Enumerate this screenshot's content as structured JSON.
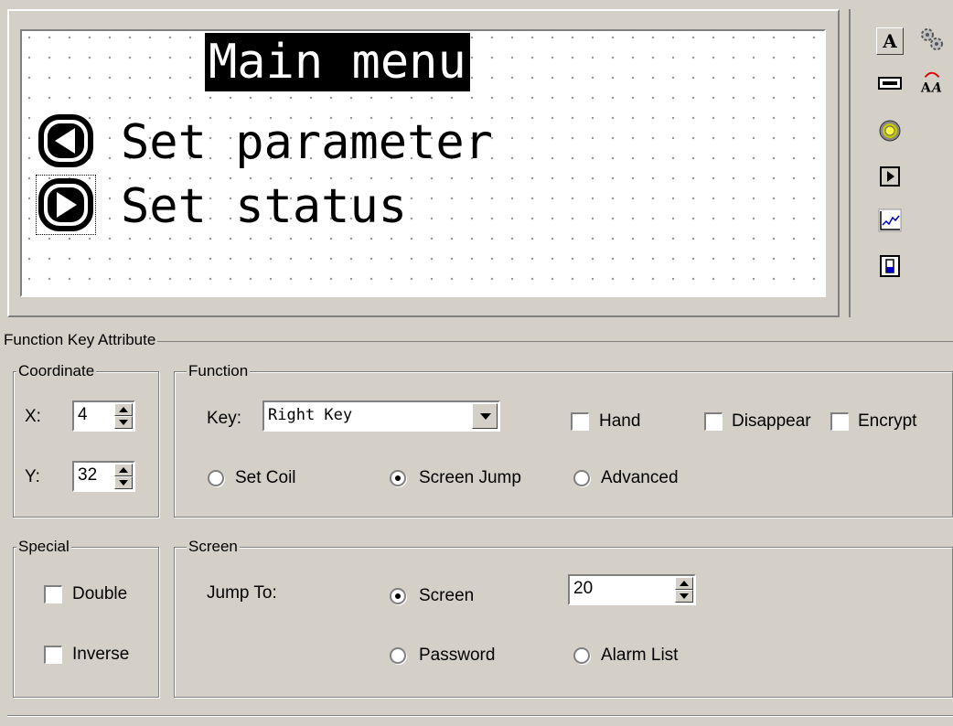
{
  "lcd": {
    "title": "Main menu",
    "line1": "Set parameter",
    "line2": "Set status"
  },
  "toolbox": {
    "text_tool_glyph": "A",
    "icons": [
      "text-icon",
      "gears-icon",
      "display-value-icon",
      "dynamic-text-icon",
      "indicator-lamp-icon",
      "function-key-icon",
      "trend-graph-icon",
      "bar-gauge-icon"
    ]
  },
  "attr": {
    "title": "Function Key Attribute",
    "coordinate": {
      "title": "Coordinate",
      "x_label": "X:",
      "x_value": "4",
      "y_label": "Y:",
      "y_value": "32"
    },
    "function": {
      "title": "Function",
      "key_label": "Key:",
      "key_value": "Right Key",
      "hand": "Hand",
      "disappear": "Disappear",
      "encrypt": "Encrypt",
      "set_coil": "Set Coil",
      "screen_jump": "Screen Jump",
      "advanced": "Advanced",
      "selected": "Screen Jump"
    },
    "special": {
      "title": "Special",
      "double": "Double",
      "inverse": "Inverse"
    },
    "screen": {
      "title": "Screen",
      "jump_to": "Jump To:",
      "screen_option": "Screen",
      "screen_value": "20",
      "password": "Password",
      "alarm_list": "Alarm List",
      "selected": "Screen"
    }
  }
}
